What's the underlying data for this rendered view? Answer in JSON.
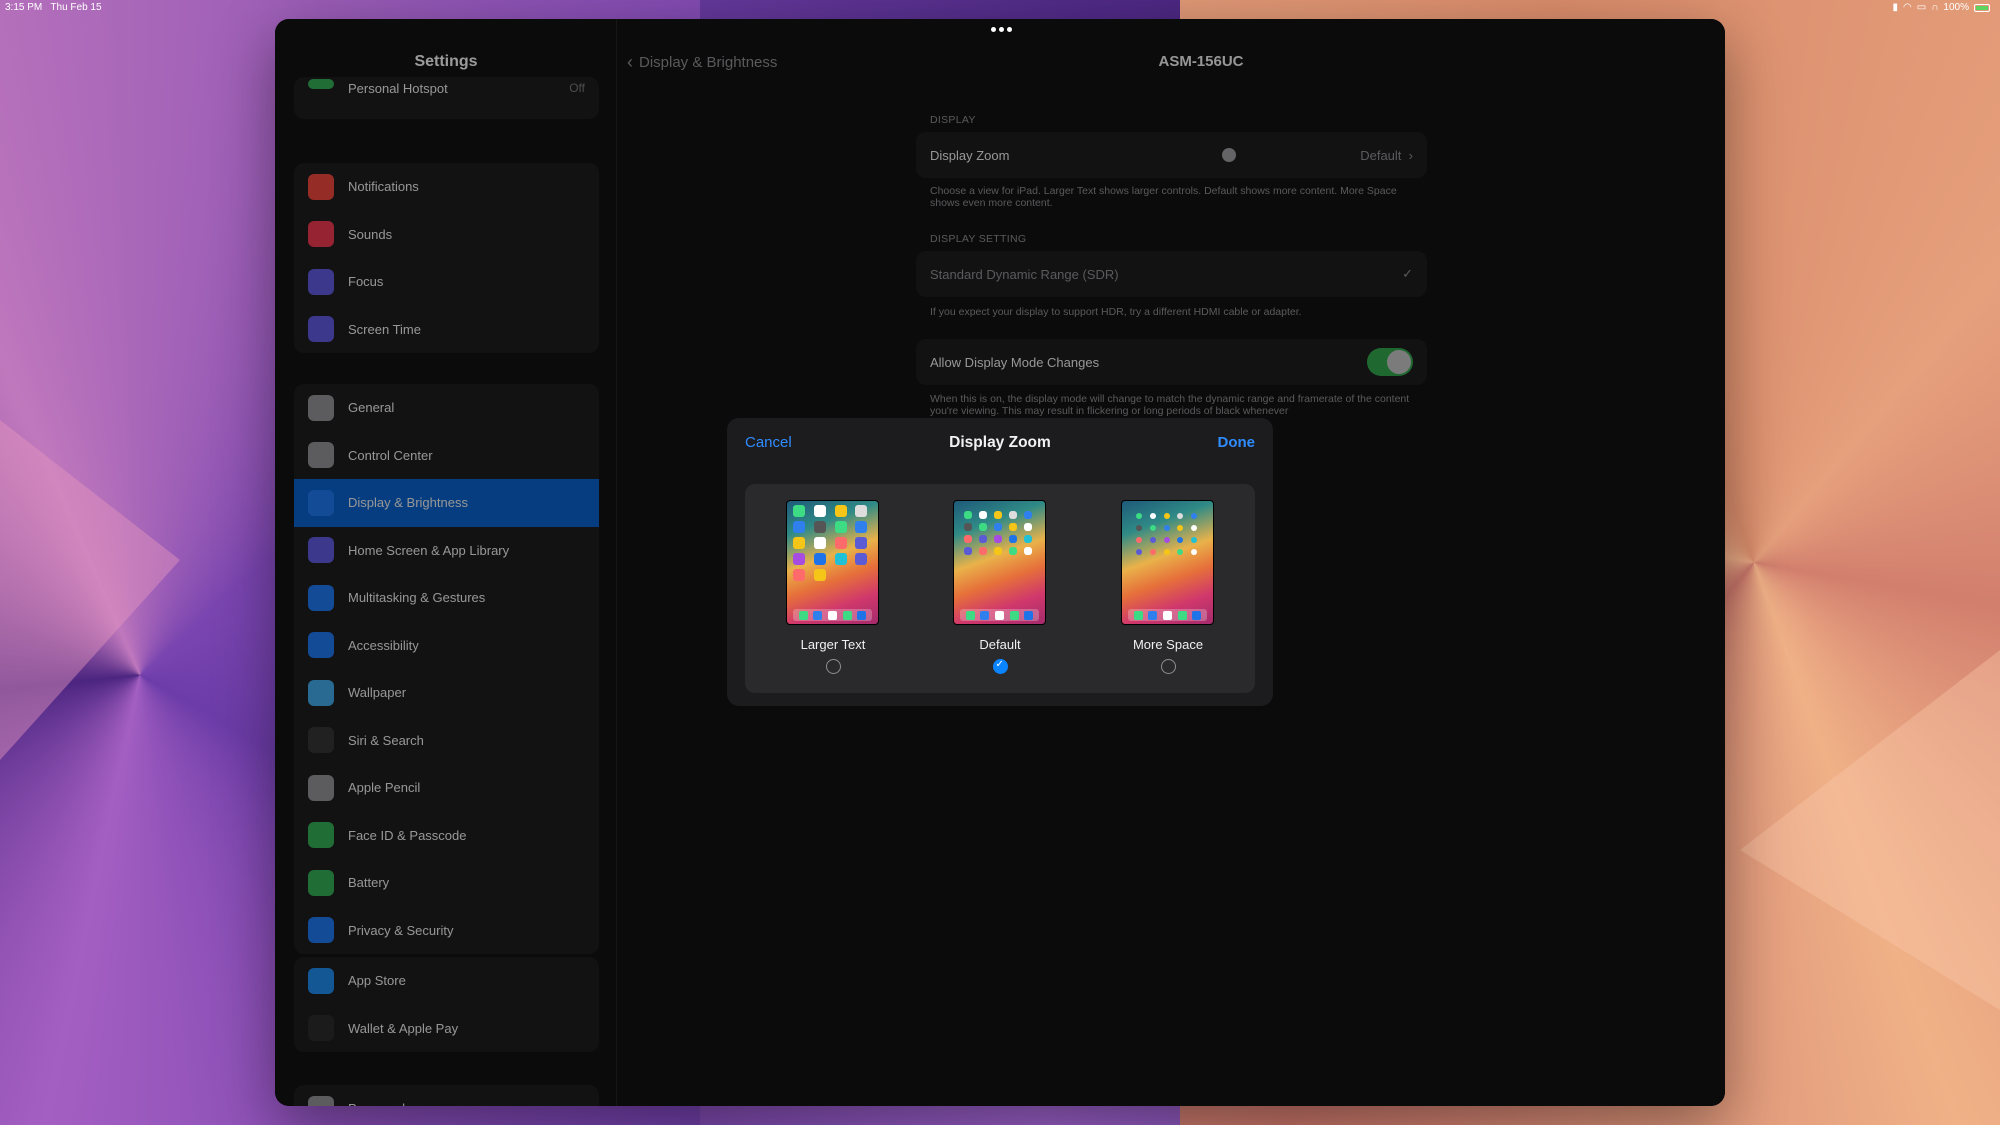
{
  "status": {
    "time": "3:15 PM",
    "date": "Thu Feb 15",
    "battery": "100%"
  },
  "sidebar": {
    "title": "Settings",
    "partial_item": {
      "label": "Personal Hotspot",
      "value": "Off"
    },
    "groups": [
      [
        {
          "label": "Notifications",
          "icon": "bell-icon",
          "color": "#e5443a"
        },
        {
          "label": "Sounds",
          "icon": "speaker-icon",
          "color": "#e5374e"
        },
        {
          "label": "Focus",
          "icon": "moon-icon",
          "color": "#5d56d6"
        },
        {
          "label": "Screen Time",
          "icon": "hourglass-icon",
          "color": "#5d56d6"
        }
      ],
      [
        {
          "label": "General",
          "icon": "gear-icon",
          "color": "#8e8e93"
        },
        {
          "label": "Control Center",
          "icon": "switches-icon",
          "color": "#8e8e93"
        },
        {
          "label": "Display & Brightness",
          "icon": "sun-icon",
          "color": "#1e73e8",
          "selected": true
        },
        {
          "label": "Home Screen & App Library",
          "icon": "grid-icon",
          "color": "#5d56d6"
        },
        {
          "label": "Multitasking & Gestures",
          "icon": "multitask-icon",
          "color": "#1e73e8"
        },
        {
          "label": "Accessibility",
          "icon": "accessibility-icon",
          "color": "#1e73e8"
        },
        {
          "label": "Wallpaper",
          "icon": "flower-icon",
          "color": "#3fa3e0"
        },
        {
          "label": "Siri & Search",
          "icon": "siri-icon",
          "color": "#333"
        },
        {
          "label": "Apple Pencil",
          "icon": "pencil-icon",
          "color": "#8e8e93"
        },
        {
          "label": "Face ID & Passcode",
          "icon": "faceid-icon",
          "color": "#34a853"
        },
        {
          "label": "Battery",
          "icon": "battery-icon",
          "color": "#34a853"
        },
        {
          "label": "Privacy & Security",
          "icon": "hand-icon",
          "color": "#1e73e8"
        }
      ],
      [
        {
          "label": "App Store",
          "icon": "appstore-icon",
          "color": "#1e88e5"
        },
        {
          "label": "Wallet & Apple Pay",
          "icon": "wallet-icon",
          "color": "#2a2a2a"
        }
      ],
      [
        {
          "label": "Passwords",
          "icon": "key-icon",
          "color": "#8e8e93"
        }
      ]
    ]
  },
  "detail": {
    "back_label": "Display & Brightness",
    "title": "ASM-156UC",
    "display_section": "DISPLAY",
    "display_zoom_label": "Display Zoom",
    "display_zoom_value": "Default",
    "display_zoom_note": "Choose a view for iPad. Larger Text shows larger controls. Default shows more content. More Space shows even more content.",
    "display_setting_section": "DISPLAY SETTING",
    "sdr_label": "Standard Dynamic Range (SDR)",
    "sdr_note": "If you expect your display to support HDR, try a different HDMI cable or adapter.",
    "mode_changes_label": "Allow Display Mode Changes",
    "mode_changes_note": "When this is on, the display mode will change to match the dynamic range and framerate of the content you're viewing. This may result in flickering or long periods of black whenever"
  },
  "modal": {
    "cancel": "Cancel",
    "title": "Display Zoom",
    "done": "Done",
    "options": [
      {
        "label": "Larger Text",
        "selected": false
      },
      {
        "label": "Default",
        "selected": true
      },
      {
        "label": "More Space",
        "selected": false
      }
    ]
  }
}
